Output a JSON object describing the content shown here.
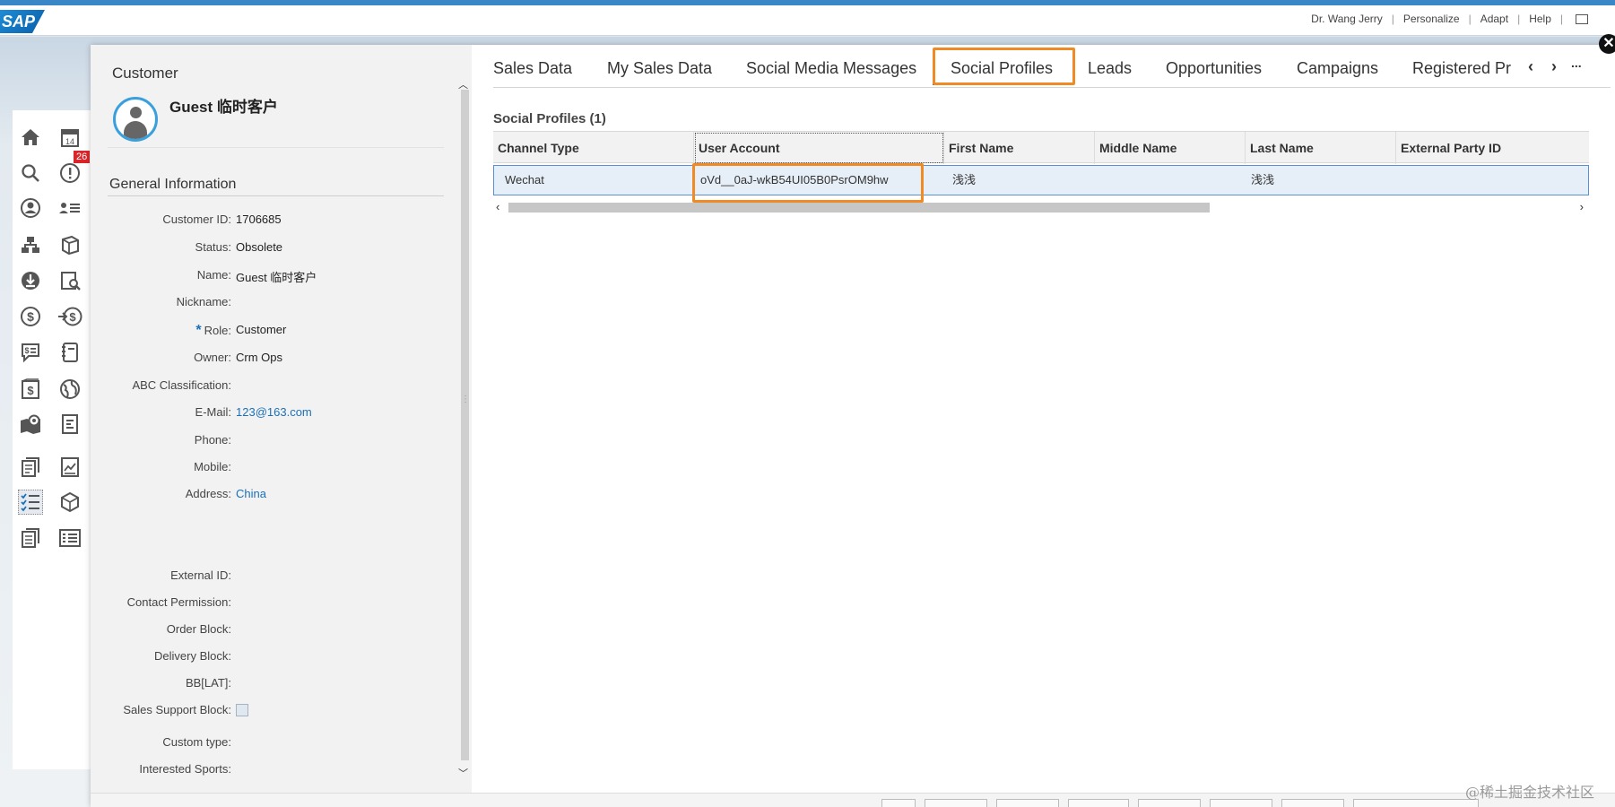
{
  "topbar": {
    "logo": "SAP",
    "user": "Dr. Wang Jerry",
    "personalize": "Personalize",
    "adapt": "Adapt",
    "help": "Help"
  },
  "rail": {
    "badge": "26",
    "icons": [
      "home-icon",
      "calendar-icon",
      "search-icon",
      "alert-icon",
      "account-icon",
      "contacts-icon",
      "org-icon",
      "product-icon",
      "download-icon",
      "analysis-icon",
      "money-icon",
      "transfer-money-icon",
      "quote-icon",
      "notebook-icon",
      "invoice-icon",
      "globe-money-icon",
      "map-icon",
      "report-icon",
      "documents-icon",
      "chart-doc-icon",
      "checklist-icon",
      "box-icon",
      "forms-icon",
      "list-icon"
    ],
    "calendar_day": "14"
  },
  "customer": {
    "panel_title": "Customer",
    "name": "Guest 临时客户",
    "section": "General Information",
    "fields": [
      {
        "label": "Customer ID:",
        "value": "1706685"
      },
      {
        "label": "Status:",
        "value": "Obsolete"
      },
      {
        "label": "Name:",
        "value": "Guest 临时客户"
      },
      {
        "label": "Nickname:",
        "value": ""
      },
      {
        "label": "Role:",
        "value": "Customer"
      },
      {
        "label": "Owner:",
        "value": "Crm Ops"
      },
      {
        "label": "ABC Classification:",
        "value": ""
      },
      {
        "label": "E-Mail:",
        "value": "123@163.com"
      },
      {
        "label": "Phone:",
        "value": ""
      },
      {
        "label": "Mobile:",
        "value": ""
      },
      {
        "label": "Address:",
        "value": "China"
      },
      {
        "label": "External ID:",
        "value": ""
      },
      {
        "label": "Contact Permission:",
        "value": ""
      },
      {
        "label": "Order Block:",
        "value": ""
      },
      {
        "label": "Delivery Block:",
        "value": ""
      },
      {
        "label": "BB[LAT]:",
        "value": ""
      },
      {
        "label": "Sales Support Block:",
        "value": ""
      },
      {
        "label": "Custom type:",
        "value": ""
      },
      {
        "label": "Interested Sports:",
        "value": ""
      }
    ]
  },
  "tabs": {
    "items": [
      "Sales Data",
      "My Sales Data",
      "Social Media Messages",
      "Social Profiles",
      "Leads",
      "Opportunities",
      "Campaigns",
      "Registered Pr"
    ],
    "active": "Social Profiles",
    "more": "..."
  },
  "social_profiles": {
    "title": "Social Profiles (1)",
    "columns": [
      "Channel Type",
      "User Account",
      "First Name",
      "Middle Name",
      "Last Name",
      "External Party ID"
    ],
    "rows": [
      [
        "Wechat",
        "oVd__0aJ-wkB54UI05B0PsrOM9hw",
        "浅浅",
        "",
        "浅浅",
        ""
      ]
    ]
  },
  "watermark": "@稀土掘金技术社区",
  "colors": {
    "accent": "#f08a24",
    "link": "#1b70b8",
    "selected_row": "#e6eef7"
  }
}
